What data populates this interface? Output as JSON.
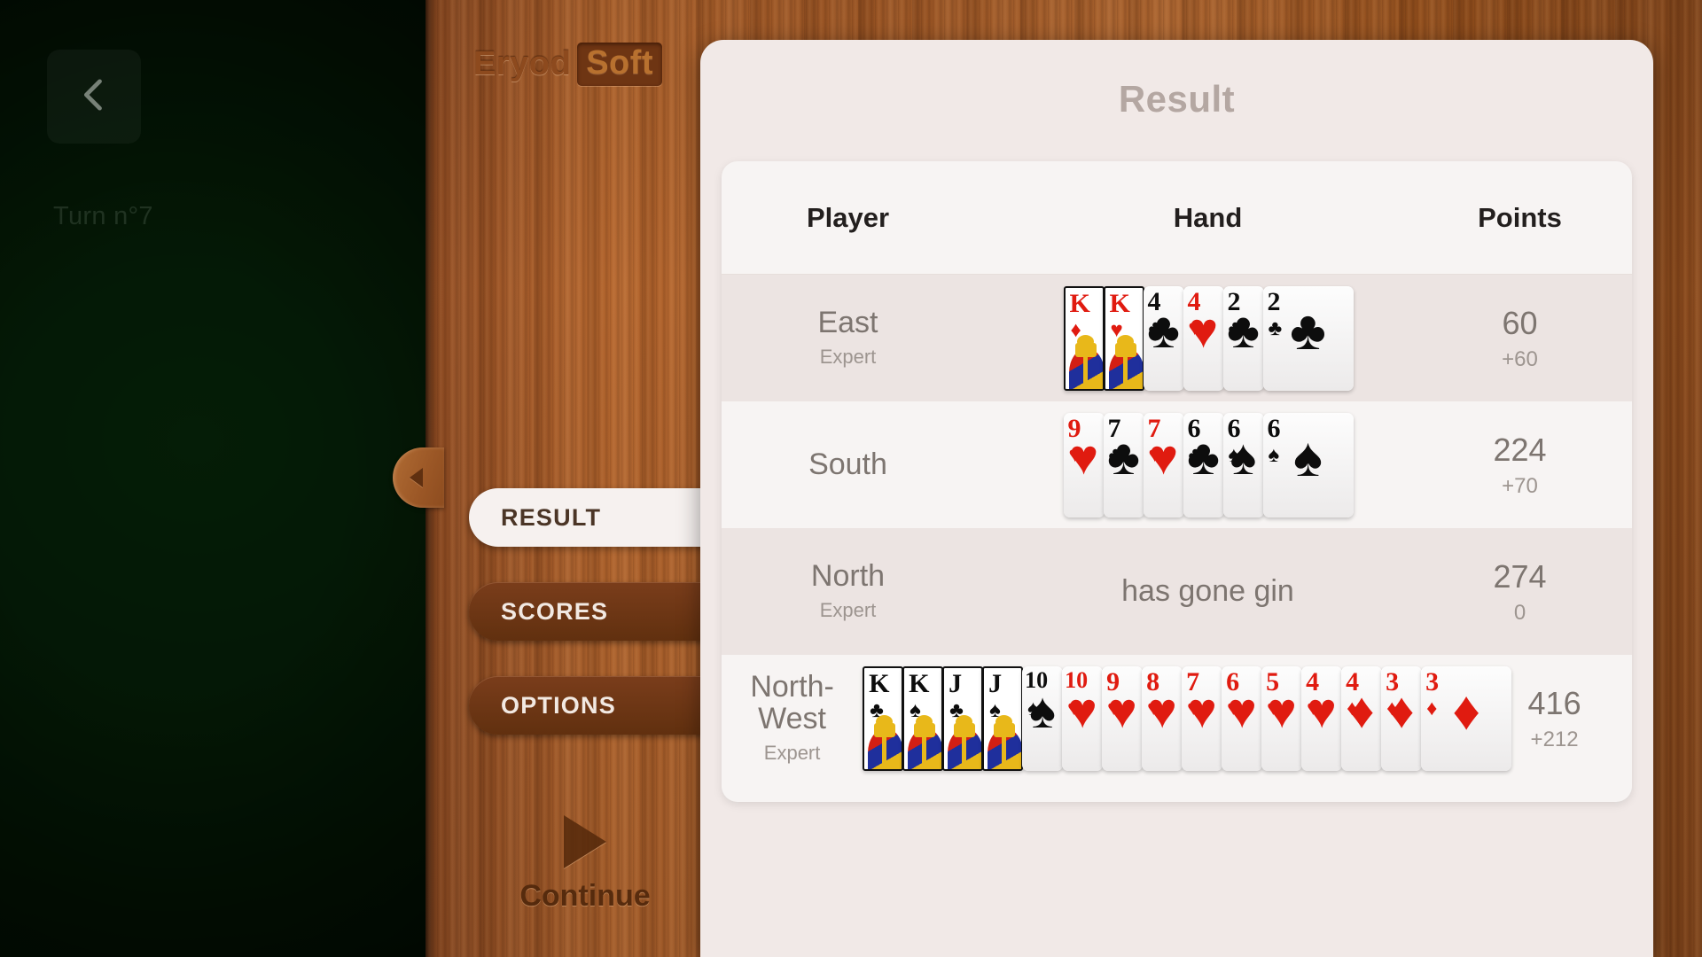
{
  "brand": {
    "name": "Eryod",
    "suffix": "Soft"
  },
  "table_view": {
    "back_icon": "chevron-left-icon",
    "turn_label": "Turn n°7"
  },
  "side_tabs": [
    {
      "label": "RESULT",
      "active": true
    },
    {
      "label": "SCORES",
      "active": false
    },
    {
      "label": "OPTIONS",
      "active": false
    }
  ],
  "continue_button": {
    "label": "Continue",
    "icon": "play-triangle-icon"
  },
  "dialog": {
    "title": "Result",
    "columns": {
      "player": "Player",
      "hand": "Hand",
      "points": "Points"
    },
    "rows": [
      {
        "player": "East",
        "level": "Expert",
        "points": "60",
        "delta": "+60",
        "message": "",
        "cards": [
          {
            "rank": "K",
            "suit": "♦",
            "color": "red",
            "face": true
          },
          {
            "rank": "K",
            "suit": "♥",
            "color": "red",
            "face": true
          },
          {
            "rank": "4",
            "suit": "♣",
            "color": "black",
            "face": false
          },
          {
            "rank": "4",
            "suit": "♥",
            "color": "red",
            "face": false
          },
          {
            "rank": "2",
            "suit": "♣",
            "color": "black",
            "face": false
          },
          {
            "rank": "2",
            "suit": "♣",
            "color": "black",
            "face": false
          }
        ]
      },
      {
        "player": "South",
        "level": "",
        "points": "224",
        "delta": "+70",
        "message": "",
        "cards": [
          {
            "rank": "9",
            "suit": "♥",
            "color": "red",
            "face": false
          },
          {
            "rank": "7",
            "suit": "♣",
            "color": "black",
            "face": false
          },
          {
            "rank": "7",
            "suit": "♥",
            "color": "red",
            "face": false
          },
          {
            "rank": "6",
            "suit": "♣",
            "color": "black",
            "face": false
          },
          {
            "rank": "6",
            "suit": "♠",
            "color": "black",
            "face": false
          },
          {
            "rank": "6",
            "suit": "♠",
            "color": "black",
            "face": false
          }
        ]
      },
      {
        "player": "North",
        "level": "Expert",
        "points": "274",
        "delta": "0",
        "message": "has gone gin",
        "cards": []
      },
      {
        "player": "North-West",
        "level": "Expert",
        "points": "416",
        "delta": "+212",
        "message": "",
        "cards": [
          {
            "rank": "K",
            "suit": "♣",
            "color": "black",
            "face": true
          },
          {
            "rank": "K",
            "suit": "♠",
            "color": "black",
            "face": true
          },
          {
            "rank": "J",
            "suit": "♣",
            "color": "black",
            "face": true
          },
          {
            "rank": "J",
            "suit": "♠",
            "color": "black",
            "face": true
          },
          {
            "rank": "10",
            "suit": "♠",
            "color": "black",
            "face": false
          },
          {
            "rank": "10",
            "suit": "♥",
            "color": "red",
            "face": false
          },
          {
            "rank": "9",
            "suit": "♥",
            "color": "red",
            "face": false
          },
          {
            "rank": "8",
            "suit": "♥",
            "color": "red",
            "face": false
          },
          {
            "rank": "7",
            "suit": "♥",
            "color": "red",
            "face": false
          },
          {
            "rank": "6",
            "suit": "♥",
            "color": "red",
            "face": false
          },
          {
            "rank": "5",
            "suit": "♥",
            "color": "red",
            "face": false
          },
          {
            "rank": "4",
            "suit": "♥",
            "color": "red",
            "face": false
          },
          {
            "rank": "4",
            "suit": "♦",
            "color": "red",
            "face": false
          },
          {
            "rank": "3",
            "suit": "♦",
            "color": "red",
            "face": false
          },
          {
            "rank": "3",
            "suit": "♦",
            "color": "red",
            "face": false
          }
        ]
      }
    ]
  },
  "colors": {
    "felt": "#0a3a0e",
    "wood": "#a85c27",
    "dialog_bg": "#f1e9e7",
    "row_alt": "#ece4e2",
    "text_muted": "#7d7570",
    "card_red": "#e01b10",
    "card_black": "#0d0d0d",
    "tab_active_bg": "#f6f1ef",
    "tab_idle_bg": "#6e3513"
  }
}
